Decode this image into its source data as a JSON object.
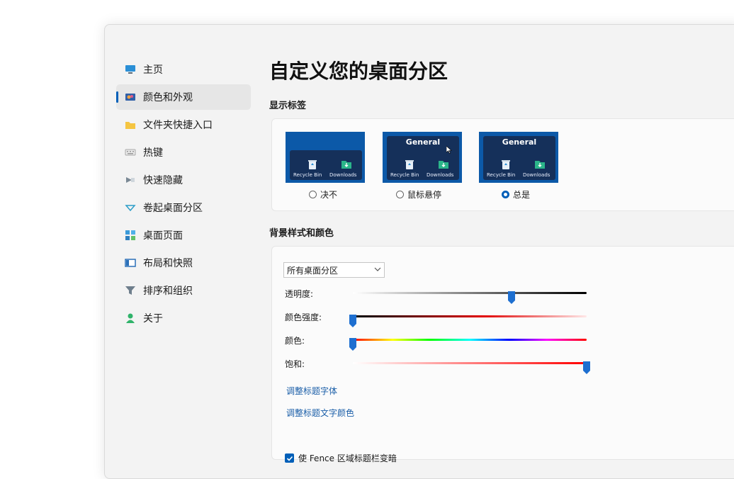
{
  "nav": {
    "items": [
      {
        "label": "主页",
        "icon": "monitor-icon"
      },
      {
        "label": "颜色和外观",
        "icon": "palette-icon",
        "selected": true
      },
      {
        "label": "文件夹快捷入口",
        "icon": "folder-icon"
      },
      {
        "label": "热键",
        "icon": "keyboard-icon"
      },
      {
        "label": "快速隐藏",
        "icon": "hide-icon"
      },
      {
        "label": "卷起桌面分区",
        "icon": "rollup-icon"
      },
      {
        "label": "桌面页面",
        "icon": "desktop-pages-icon"
      },
      {
        "label": "布局和快照",
        "icon": "layout-icon"
      },
      {
        "label": "排序和组织",
        "icon": "filter-icon"
      },
      {
        "label": "关于",
        "icon": "person-icon"
      }
    ]
  },
  "page": {
    "title": "自定义您的桌面分区"
  },
  "labels_section": {
    "title": "显示标签",
    "options": [
      {
        "label": "决不",
        "checked": false,
        "header": ""
      },
      {
        "label": "鼠标悬停",
        "checked": false,
        "header": "General"
      },
      {
        "label": "总是",
        "checked": true,
        "header": "General"
      }
    ],
    "preview_items": [
      "Recycle Bin",
      "Downloads"
    ]
  },
  "background_section": {
    "title": "背景样式和颜色",
    "dropdown_value": "所有桌面分区",
    "sliders": [
      {
        "label": "透明度:",
        "value_pct": 68
      },
      {
        "label": "颜色强度:",
        "value_pct": 0
      },
      {
        "label": "颜色:",
        "value_pct": 0
      },
      {
        "label": "饱和:",
        "value_pct": 100
      }
    ],
    "links": [
      "调整标题字体",
      "调整标题文字颜色"
    ],
    "checkbox_label": "使 Fence 区域标题栏变暗"
  },
  "colors": {
    "accent": "#005fb8",
    "preview_bg": "#0c59a8",
    "panel": "#15305a"
  }
}
